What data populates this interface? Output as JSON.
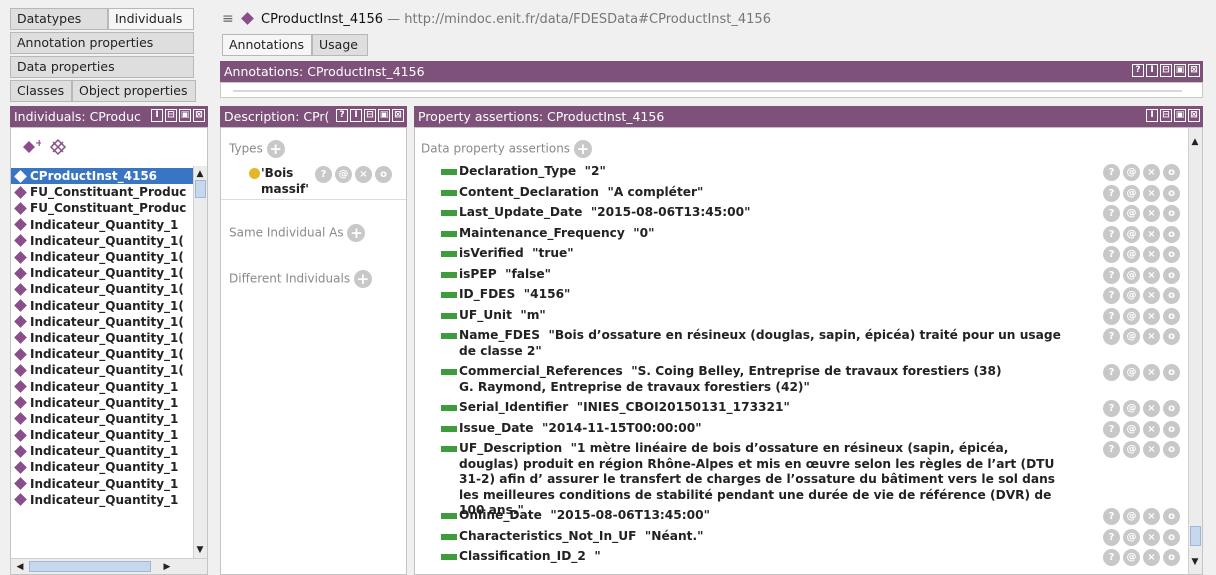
{
  "left_tabs": {
    "datatypes": "Datatypes",
    "individuals": "Individuals",
    "annotation_properties": "Annotation properties",
    "data_properties": "Data properties",
    "classes": "Classes",
    "object_properties": "Object properties"
  },
  "header": {
    "entity_name": "CProductInst_4156",
    "entity_iri": "— http://mindoc.enit.fr/data/FDESData#CProductInst_4156"
  },
  "main_tabs": [
    "Annotations",
    "Usage"
  ],
  "annotations_bar": "Annotations: CProductInst_4156",
  "individuals_panel": {
    "title": "Individuals: CProduc",
    "items": [
      "CProductInst_4156",
      "FU_Constituant_Produc",
      "FU_Constituant_Produc",
      "Indicateur_Quantity_1",
      "Indicateur_Quantity_1(",
      "Indicateur_Quantity_1(",
      "Indicateur_Quantity_1(",
      "Indicateur_Quantity_1(",
      "Indicateur_Quantity_1(",
      "Indicateur_Quantity_1(",
      "Indicateur_Quantity_1(",
      "Indicateur_Quantity_1(",
      "Indicateur_Quantity_1(",
      "Indicateur_Quantity_1",
      "Indicateur_Quantity_1",
      "Indicateur_Quantity_1",
      "Indicateur_Quantity_1",
      "Indicateur_Quantity_1",
      "Indicateur_Quantity_1",
      "Indicateur_Quantity_1",
      "Indicateur_Quantity_1"
    ]
  },
  "description_panel": {
    "title": "Description: CPr(",
    "types_label": "Types",
    "type_value_line1": "'Bois",
    "type_value_line2": "massif'",
    "same_individual_label": "Same Individual As",
    "different_individuals_label": "Different Individuals"
  },
  "property_panel": {
    "title": "Property assertions: CProductInst_4156",
    "data_property_label": "Data property assertions",
    "assertions": [
      "Declaration_Type  \"2\"",
      "Content_Declaration  \"A compléter\"",
      "Last_Update_Date  \"2015-08-06T13:45:00\"",
      "Maintenance_Frequency  \"0\"",
      "isVerified  \"true\"",
      "isPEP  \"false\"",
      "ID_FDES  \"4156\"",
      "UF_Unit  \"m\"",
      "Name_FDES  \"Bois d’ossature en résineux (douglas, sapin, épicéa) traité pour un usage de classe 2\"",
      "Commercial_References  \"S. Coing Belley, Entreprise de travaux forestiers (38)\nG. Raymond, Entreprise de travaux forestiers (42)\"",
      "Serial_Identifier  \"INIES_CBOI20150131_173321\"",
      "Issue_Date  \"2014-11-15T00:00:00\"",
      "UF_Description  \"1 mètre linéaire de bois d’ossature en résineux (sapin, épicéa, douglas) produit en région Rhône-Alpes et mis en œuvre selon les règles de l’art (DTU 31-2) afin d’ assurer le transfert de charges de l’ossature du bâtiment vers le sol dans les meilleures conditions de stabilité pendant une durée de vie de référence (DVR) de 100 ans.\"",
      "Online_Date  \"2015-08-06T13:45:00\"",
      "Characteristics_Not_In_UF  \"Néant.\"",
      "Classification_ID_2  \""
    ]
  },
  "window_icons": {
    "annotations": [
      "?",
      "I",
      "⊟",
      "▣",
      "⊠"
    ],
    "panel": [
      "I",
      "⊟",
      "▣",
      "⊠"
    ],
    "description": [
      "?",
      "I",
      "⊟",
      "▣",
      "⊠"
    ]
  },
  "row_icon_glyphs": [
    "?",
    "@",
    "×",
    "o"
  ],
  "colors": {
    "title_bar": "#7d5179",
    "selection": "#3a75c4",
    "individual_diamond": "#8a4f8a",
    "data_property_bullet": "#3e9c3e",
    "type_dot": "#e5b626"
  }
}
